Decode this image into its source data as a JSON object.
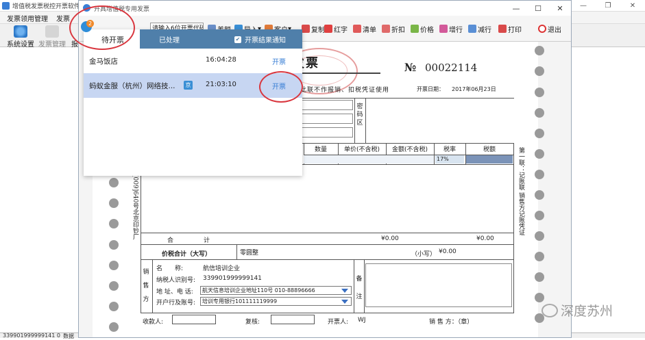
{
  "bg_app": {
    "title": "增值税发票税控开票软件",
    "menu": [
      "发票领用管理",
      "发票"
    ],
    "toolbar_labels": [
      "系统设置",
      "发票管理",
      "报"
    ],
    "status_left": "339901999999141 0",
    "status_right": "数据"
  },
  "dialog": {
    "title": "开具增值税专用发票",
    "win_buttons": [
      "—",
      "☐",
      "✕"
    ]
  },
  "toolbar": {
    "code_input": "请输入6位开票代码",
    "buttons": [
      "差额",
      "导入",
      "客户",
      "复制",
      "红字",
      "清单",
      "折扣",
      "价格",
      "增行",
      "减行",
      "打印",
      "退出"
    ]
  },
  "invoice": {
    "title": "增值税专用发票",
    "no_label": "№",
    "number": "00022114",
    "subtitle": "此联不作报销、扣税凭证使用",
    "date_label": "开票日期：",
    "date": "2017年06月23日",
    "password_area_label": "密码区",
    "columns": [
      "数量",
      "单价(不含税)",
      "金额(不含税)",
      "税率",
      "税额"
    ],
    "tax_rate": "17%",
    "left_vertical": "[009]640号北京印钞厂",
    "right_vertical": "第一联：记账联 销售方记账凭证",
    "sum_label": "合",
    "sum_label2": "计",
    "sum_amount": "¥0.00",
    "sum_tax": "¥0.00",
    "total_label": "价税合计（大写）",
    "total_capital": "零圆整",
    "total_small_label": "（小写）",
    "total_small": "¥0.00",
    "seller_side_label": "销售方",
    "seller": {
      "name_label": "名　　称:",
      "name": "航信培训企业",
      "taxid_label": "纳税人识别号:",
      "taxid": "339901999999141",
      "addr_label": "地 址、电 话:",
      "addr": "航天信息培训企业地址110号 010-88896666",
      "bank_label": "开户行及账号:",
      "bank": "培训专用银行101111119999"
    },
    "remark_label": "备注",
    "payee_label": "收款人:",
    "review_label": "复核:",
    "drawer_label": "开票人:",
    "drawer": "WJ",
    "seller_stamp_label": "销 售 方：（章）"
  },
  "popup": {
    "badge": "2",
    "tabs": [
      "待开票",
      "已处理",
      "开票结果通知"
    ],
    "rows": [
      {
        "name": "金马饭店",
        "time": "16:04:28",
        "action": "开票"
      },
      {
        "name": "蚂蚁金服（杭州）网络技...",
        "tag": "京",
        "time": "21:03:10",
        "action": "开票"
      }
    ]
  },
  "watermark": "深度苏州",
  "colors": {
    "accent": "#3a7fd5",
    "tab_bar": "#4f7faa",
    "highlight_row": "#c7d6f2",
    "annotation": "#d9363e"
  }
}
